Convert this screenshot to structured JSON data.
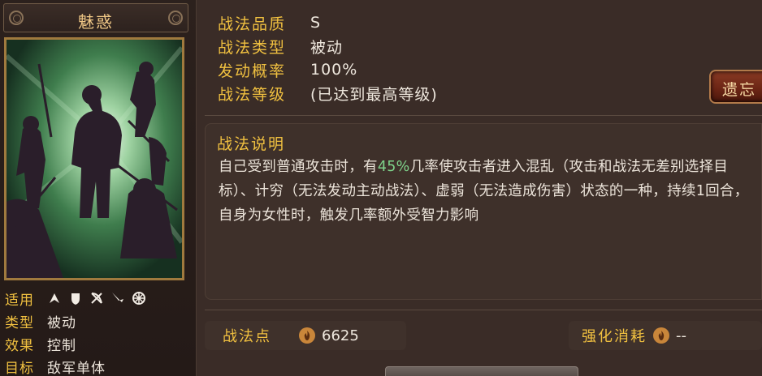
{
  "skill": {
    "name": "魅惑",
    "applicable_label": "适用",
    "applicable_icons": [
      "cavalry-icon",
      "shield-icon",
      "bow-icon",
      "spear-icon",
      "siege-icon"
    ],
    "type_label": "类型",
    "type_value": "被动",
    "effect_label": "效果",
    "effect_value": "控制",
    "target_label": "目标",
    "target_value": "敌军单体"
  },
  "info": {
    "quality_label": "战法品质",
    "quality_value": "S",
    "kind_label": "战法类型",
    "kind_value": "被动",
    "rate_label": "发动概率",
    "rate_value": "100%",
    "level_label": "战法等级",
    "level_value": "(已达到最高等级)"
  },
  "legacy_button": "遗忘",
  "description": {
    "title": "战法说明",
    "text_before": "自己受到普通攻击时，有",
    "highlight": "45%",
    "text_after": "几率使攻击者进入混乱（攻击和战法无差别选择目标）、计穷（无法发动主动战法）、虚弱（无法造成伤害）状态的一种，持续1回合，自身为女性时，触发几率额外受智力影响"
  },
  "points": {
    "label": "战法点",
    "value": "6625",
    "icon": "flame-icon"
  },
  "enhance_cost": {
    "label": "强化消耗",
    "value": "--",
    "icon": "flame-icon"
  },
  "colors": {
    "gold_label": "#f0c040",
    "highlight_green": "#7ed28a",
    "background": "#3a2c27"
  }
}
